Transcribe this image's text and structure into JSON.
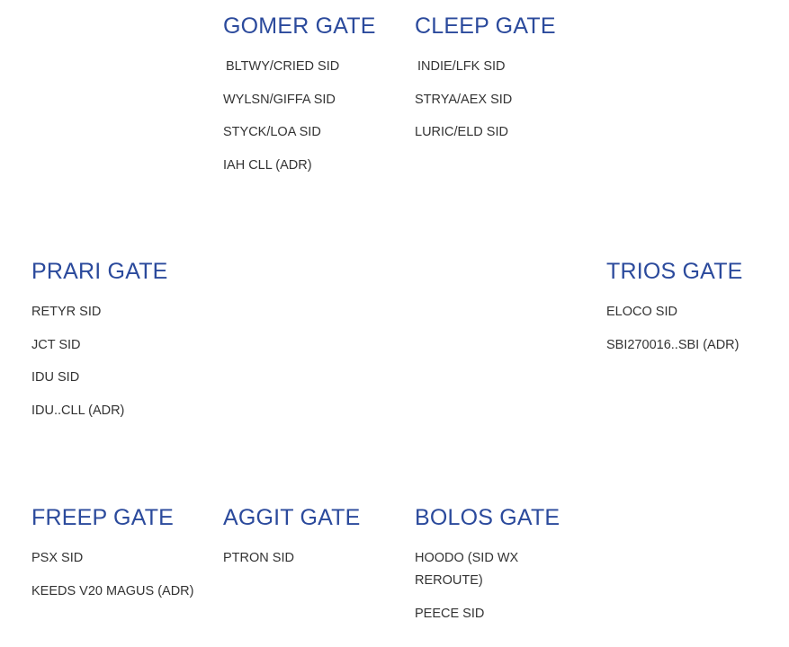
{
  "gates": {
    "gomer": {
      "title": "GOMER GATE",
      "routes": [
        "BLTWY/CRIED SID",
        "WYLSN/GIFFA SID",
        "STYCK/LOA SID",
        "IAH CLL (ADR)"
      ]
    },
    "cleep": {
      "title": "CLEEP GATE",
      "routes": [
        "INDIE/LFK SID",
        "STRYA/AEX SID",
        "LURIC/ELD SID"
      ]
    },
    "prari": {
      "title": "PRARI GATE",
      "routes": [
        "RETYR SID",
        "JCT SID",
        "IDU SID",
        "IDU..CLL (ADR)"
      ]
    },
    "trios": {
      "title": "TRIOS GATE",
      "routes": [
        "ELOCO SID",
        "SBI270016..SBI (ADR)"
      ]
    },
    "freep": {
      "title": "FREEP GATE",
      "routes": [
        "PSX SID",
        "KEEDS V20 MAGUS (ADR)"
      ]
    },
    "aggit": {
      "title": "AGGIT GATE",
      "routes": [
        "PTRON SID"
      ]
    },
    "bolos": {
      "title": "BOLOS GATE",
      "routes": [
        "HOODO (SID WX REROUTE)",
        "PEECE SID"
      ]
    }
  },
  "colors": {
    "heading": "#2b4a9c",
    "text": "#333333",
    "background": "#ffffff"
  }
}
